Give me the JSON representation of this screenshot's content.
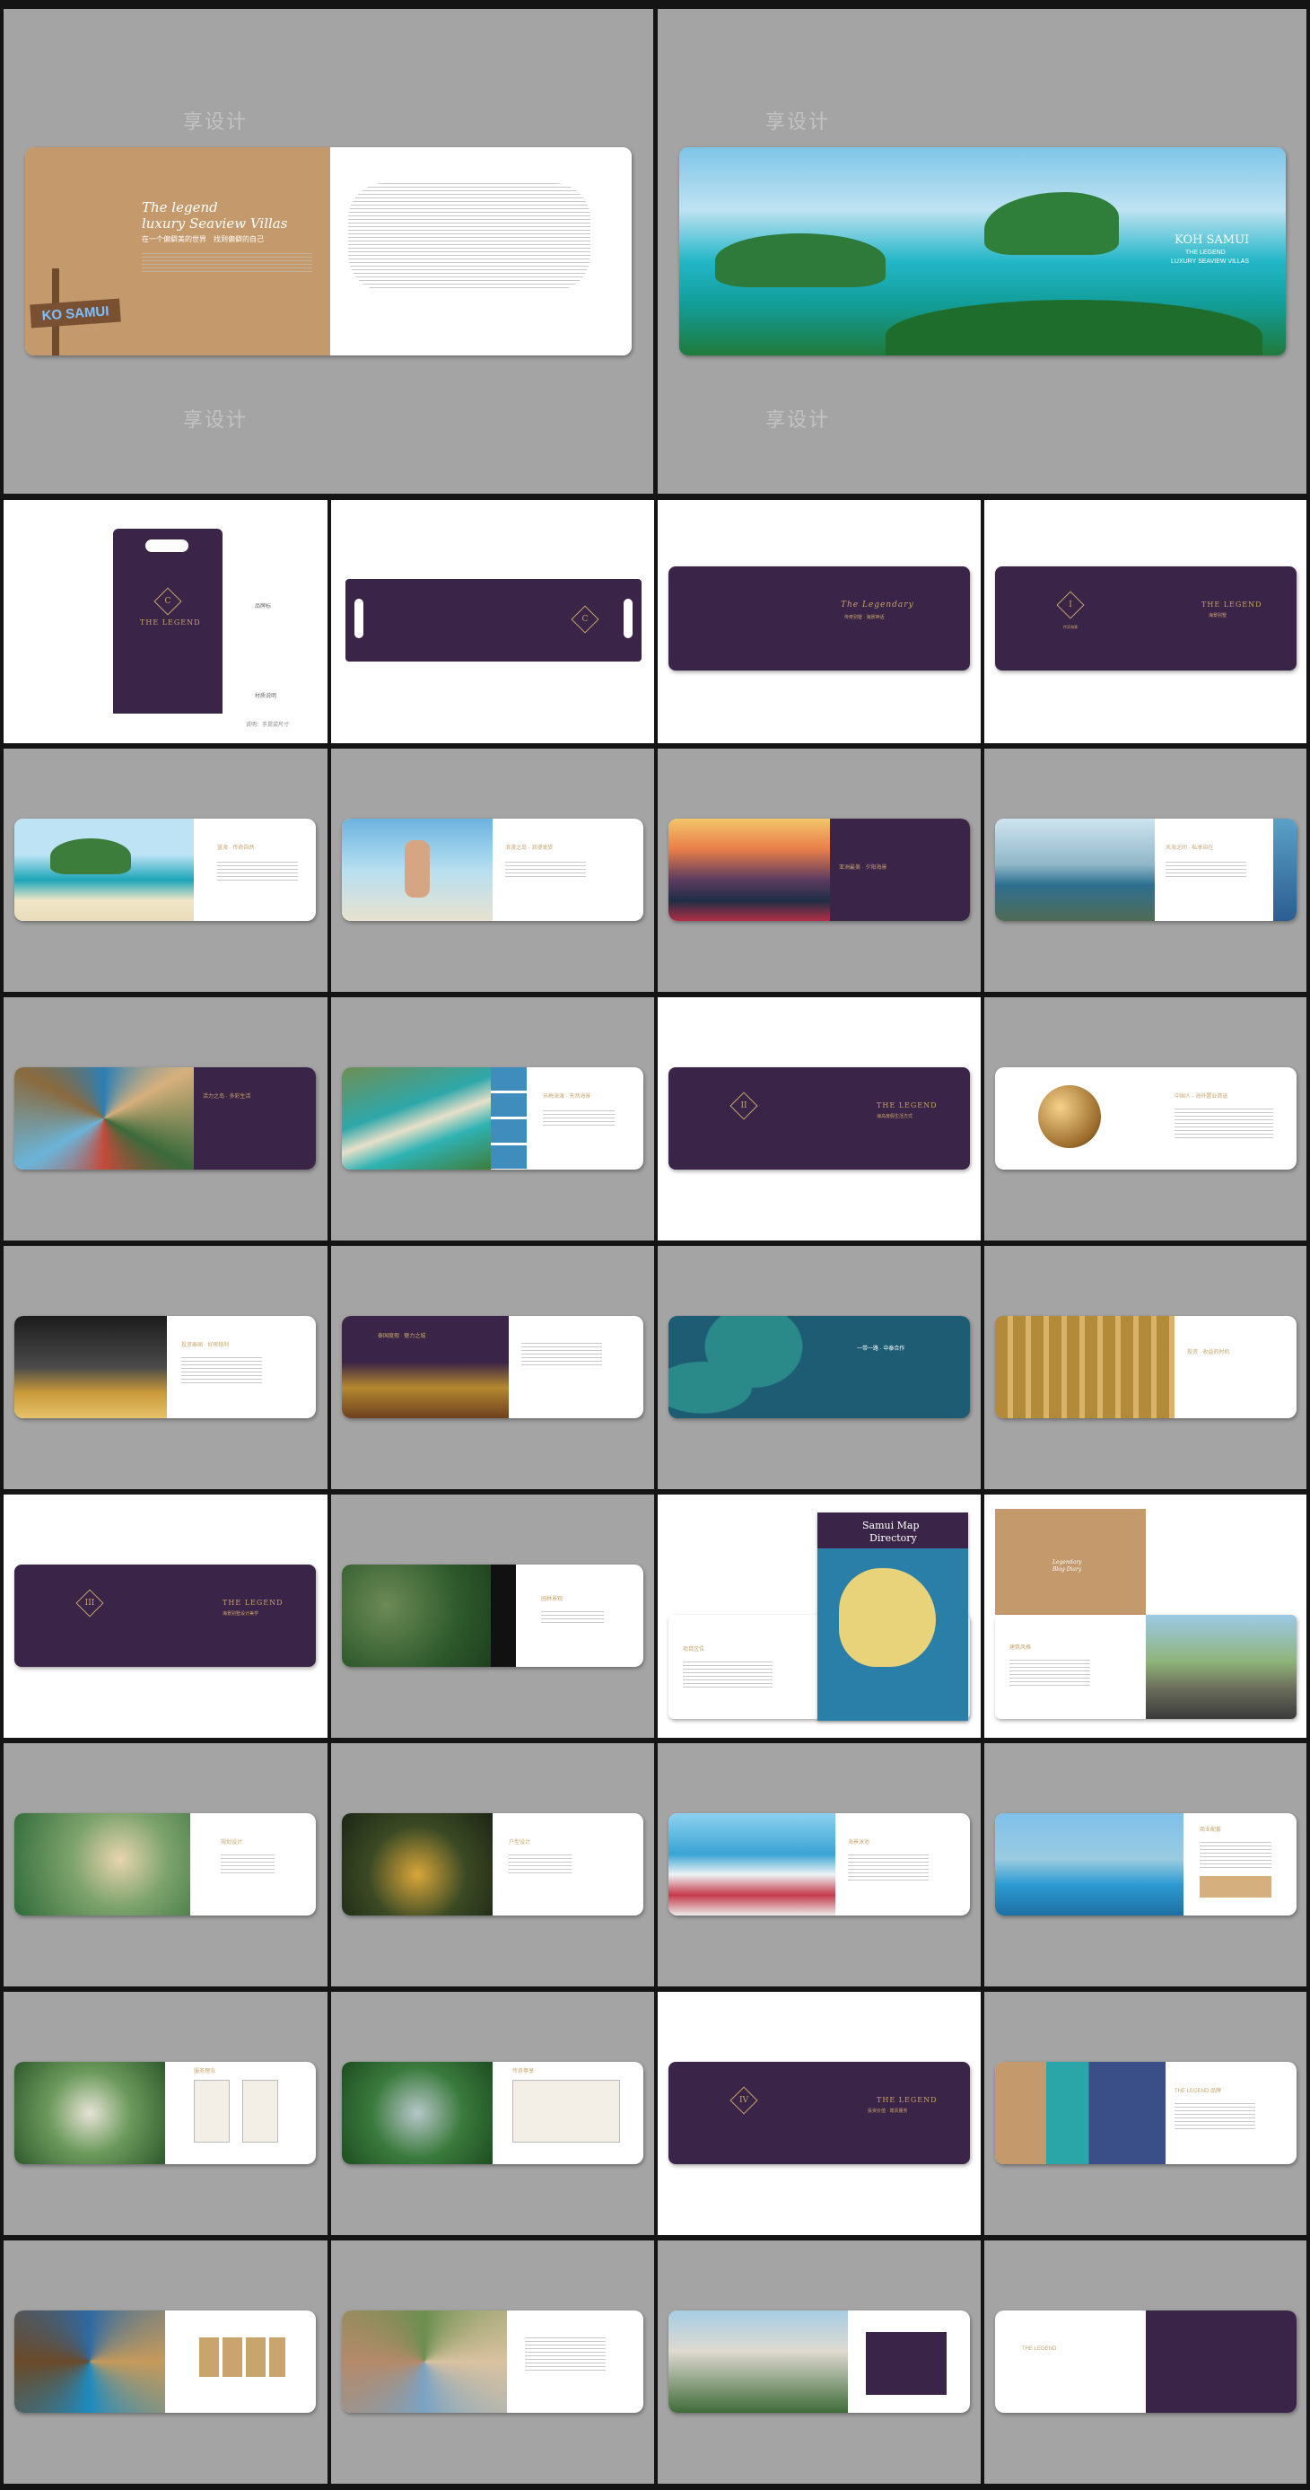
{
  "watermark": "享设计",
  "spread1": {
    "title_line1": "The legend",
    "title_line2": "luxury Seaview Villas",
    "subtitle": "在一个偏僻美的世界　找到偏僻的自己",
    "sign_text": "KO SAMUI"
  },
  "spread2": {
    "title": "KOH SAMUI",
    "sub1": "THE LEGEND",
    "sub2": "LUXURY SEAVIEW VILLAS"
  },
  "bag": {
    "brand": "THE LEGEND",
    "label_a": "品牌标",
    "label_b": "材质说明",
    "caption": "说明：手提袋尺寸"
  },
  "cover_a": {
    "title": "The Legendary",
    "sub": "传奇别墅 · 海景神话"
  },
  "chapter1": {
    "numeral": "I",
    "title": "THE LEGEND",
    "sub": "海景别墅",
    "caption": "传奇海景"
  },
  "chapter2": {
    "numeral": "II",
    "title": "THE LEGEND",
    "sub": "海岛度假生活方式"
  },
  "chapter3": {
    "numeral": "III",
    "title": "THE LEGEND",
    "sub": "海景别墅设计美学"
  },
  "chapter4": {
    "numeral": "IV",
    "title": "THE LEGEND",
    "sub": "投资价值 · 尊贵服务"
  },
  "samui_map": {
    "title_line1": "Samui Map",
    "title_line2": "Directory"
  },
  "luxury_cover": {
    "line1": "Legendary",
    "line2": "Blog Diary"
  },
  "brand_strip": "THE LEGEND",
  "headings": {
    "p1": "蓝海 · 传奇自然",
    "p2": "浪漫之岛 · 浪漫享受",
    "p3": "亚洲最美 · 夕阳海景",
    "p4": "天海之间 · 私享自在",
    "p5": "活力之岛 · 多彩生活",
    "p6": "苏梅海滩 · 天然海景",
    "p7": "中国人 · 海外置业首选",
    "p8": "投资泰国 · 好房稳利",
    "p9": "泰国度假 · 魅力之城",
    "p10": "一带一路 · 中泰合作",
    "p11": "投资 · 收益的时机",
    "p12": "园林景观",
    "p13": "项目区位",
    "p14": "建筑风格",
    "p15": "规划设计",
    "p16": "户型设计",
    "p17": "海景泳池",
    "p18": "商业配套",
    "p19": "服务理念",
    "p20": "传奇尊享",
    "p21": "THE LEGEND 品牌"
  }
}
